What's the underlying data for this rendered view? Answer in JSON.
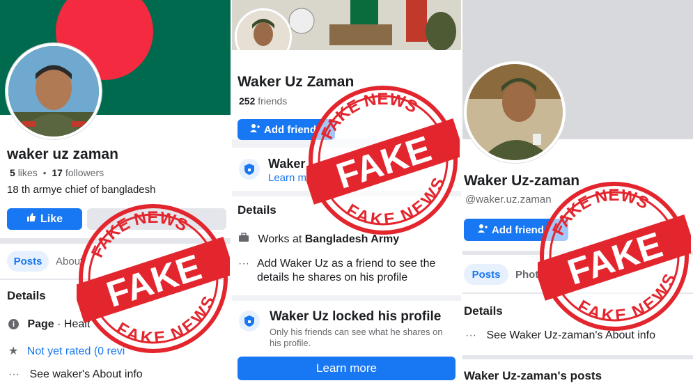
{
  "panel1": {
    "name": "waker uz zaman",
    "likes_count": "5",
    "likes_label": "likes",
    "bullet": "•",
    "followers_count": "17",
    "followers_label": "followers",
    "bio": "18 th armye chief of bangladesh",
    "like_button": "Like",
    "tab_posts": "Posts",
    "tab_about": "About",
    "details_heading": "Details",
    "page_label": "Page",
    "page_category": "· Healt",
    "rating": "Not yet rated (0 revi",
    "about_info": "See waker's About info",
    "colors": {
      "flag_green": "#006a4e",
      "flag_red": "#f42a41",
      "brand_blue": "#1877f2"
    }
  },
  "panel2": {
    "name": "Waker Uz Zaman",
    "friends_count": "252",
    "friends_label": "friends",
    "add_friend_button": "Add friend",
    "locked_banner_title": "Waker",
    "locked_banner_link": "Learn m",
    "details_heading": "Details",
    "works_prefix": "Works at ",
    "works_place": "Bangladesh Army",
    "add_friend_note": "Add Waker Uz as a friend to see the details he shares on his profile",
    "locked_title": "Waker Uz locked his profile",
    "locked_desc": "Only his friends can see what he shares on his profile.",
    "learn_more_button": "Learn more"
  },
  "panel3": {
    "name": "Waker Uz-zaman",
    "handle": "@waker.uz.zaman",
    "add_friend_button": "Add friend",
    "tab_posts": "Posts",
    "tab_photos": "Photo",
    "details_heading": "Details",
    "about_info": "See Waker Uz-zaman's About info",
    "posts_heading": "Waker Uz-zaman's posts"
  },
  "stamp": {
    "top_text": "FAKE NEWS",
    "main_text": "FAKE",
    "bottom_text": "FAKE NEWS",
    "color": "#e3262e"
  },
  "icons": [
    "add-friend-icon",
    "like-thumb-icon",
    "shield-lock-icon",
    "briefcase-icon",
    "more-dots-icon",
    "info-icon",
    "star-icon"
  ]
}
